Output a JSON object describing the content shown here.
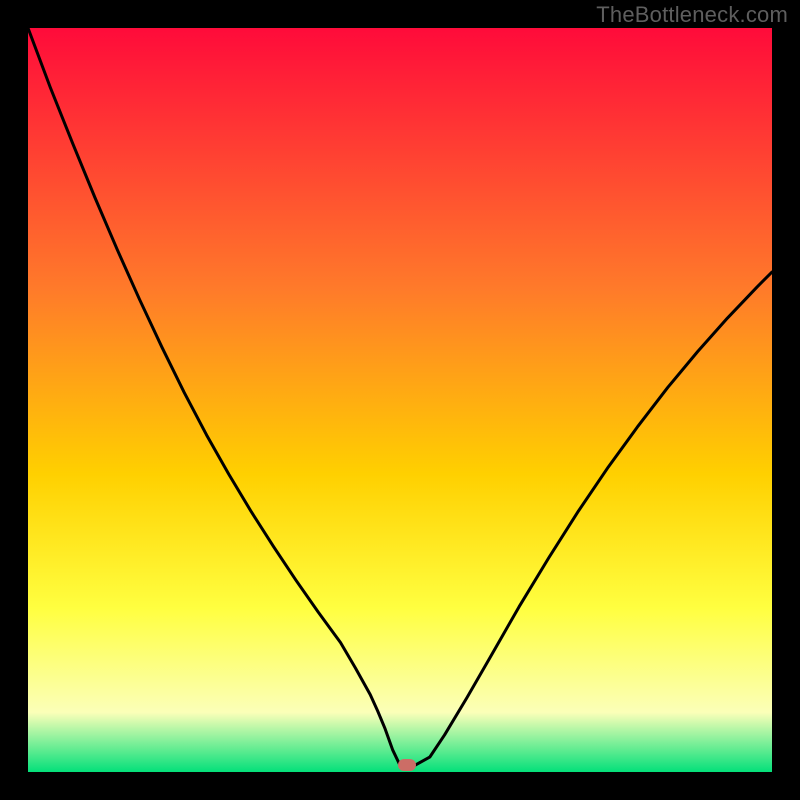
{
  "watermark": "TheBottleneck.com",
  "gradient": {
    "top": "#ff0b3a",
    "mid1": "#ff7a2a",
    "mid2": "#ffd000",
    "mid3": "#ffff40",
    "mid4": "#fbffb8",
    "bottom": "#04e07a"
  },
  "chart_data": {
    "type": "line",
    "title": "",
    "xlabel": "",
    "ylabel": "",
    "xlim": [
      0,
      100
    ],
    "ylim": [
      0,
      100
    ],
    "series": [
      {
        "name": "curve",
        "x": [
          0,
          3,
          6,
          9,
          12,
          15,
          18,
          21,
          24,
          27,
          30,
          33,
          36,
          39,
          42,
          44,
          46,
          47,
          48,
          49,
          50,
          51,
          52,
          54,
          56,
          59,
          62,
          66,
          70,
          74,
          78,
          82,
          86,
          90,
          94,
          98,
          100
        ],
        "y": [
          100,
          92,
          84.5,
          77.2,
          70.2,
          63.5,
          57.1,
          51.0,
          45.3,
          40.0,
          35.0,
          30.3,
          25.8,
          21.5,
          17.4,
          14.0,
          10.4,
          8.2,
          5.8,
          3.0,
          0.9,
          0.9,
          0.9,
          2.0,
          5.0,
          10.0,
          15.2,
          22.2,
          28.8,
          35.1,
          41.0,
          46.5,
          51.7,
          56.5,
          61.0,
          65.2,
          67.2
        ]
      }
    ],
    "marker": {
      "x": 51,
      "y": 0.9,
      "color": "#cc6d66"
    },
    "grid": false,
    "legend": false
  }
}
